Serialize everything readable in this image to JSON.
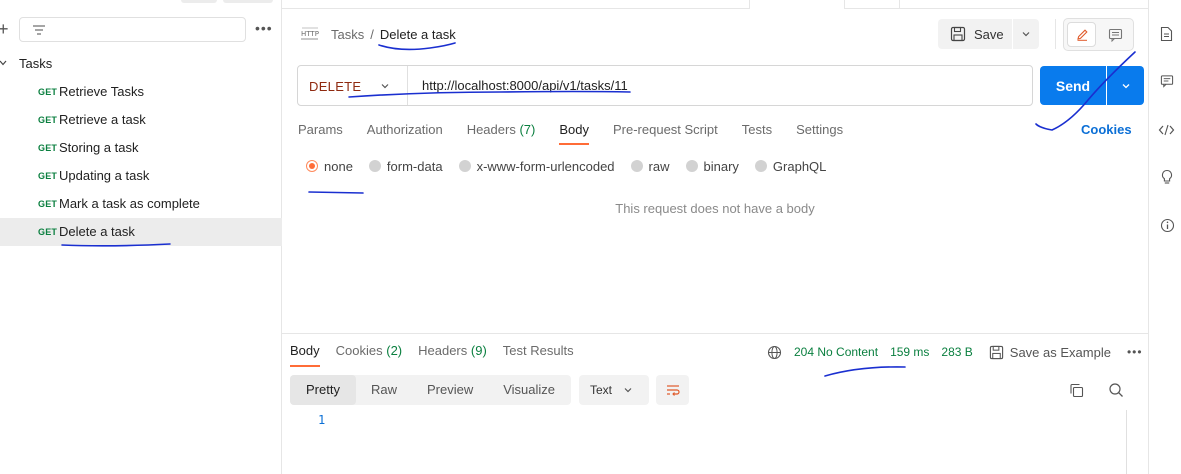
{
  "sidebar": {
    "collection_name": "Tasks",
    "requests": [
      {
        "method": "GET",
        "name": "Retrieve Tasks"
      },
      {
        "method": "GET",
        "name": "Retrieve a task"
      },
      {
        "method": "GET",
        "name": "Storing a task"
      },
      {
        "method": "GET",
        "name": "Updating a task"
      },
      {
        "method": "GET",
        "name": "Mark a task as complete"
      },
      {
        "method": "GET",
        "name": "Delete a task",
        "active": true
      }
    ]
  },
  "header": {
    "breadcrumb_parent": "Tasks",
    "breadcrumb_separator": "/",
    "breadcrumb_current": "Delete a task",
    "save_label": "Save"
  },
  "request": {
    "method": "DELETE",
    "url": "http://localhost:8000/api/v1/tasks/11",
    "send_label": "Send",
    "tabs": [
      {
        "label": "Params"
      },
      {
        "label": "Authorization"
      },
      {
        "label": "Headers",
        "count": "(7)"
      },
      {
        "label": "Body",
        "active": true
      },
      {
        "label": "Pre-request Script"
      },
      {
        "label": "Tests"
      },
      {
        "label": "Settings"
      }
    ],
    "cookies_label": "Cookies",
    "body_types": [
      {
        "label": "none",
        "selected": true
      },
      {
        "label": "form-data"
      },
      {
        "label": "x-www-form-urlencoded"
      },
      {
        "label": "raw"
      },
      {
        "label": "binary"
      },
      {
        "label": "GraphQL"
      }
    ],
    "no_body_text": "This request does not have a body"
  },
  "response": {
    "tabs": [
      {
        "label": "Body",
        "active": true
      },
      {
        "label": "Cookies",
        "count": "(2)"
      },
      {
        "label": "Headers",
        "count": "(9)"
      },
      {
        "label": "Test Results"
      }
    ],
    "status": "204 No Content",
    "time": "159 ms",
    "size": "283 B",
    "save_example_label": "Save as Example",
    "views": [
      "Pretty",
      "Raw",
      "Preview",
      "Visualize"
    ],
    "active_view": "Pretty",
    "format": "Text",
    "line_number": "1"
  },
  "colors": {
    "accent_orange": "#ff6c37",
    "send_blue": "#097bed",
    "get_green": "#0a7f3f",
    "delete_red": "#8f2a10",
    "annotation_ink": "#1a2fd0"
  },
  "icons": {
    "http": "http-icon",
    "save": "floppy-disk-icon",
    "edit": "pencil-icon",
    "comments": "comment-icon",
    "globe": "globe-icon",
    "copy": "copy-icon",
    "search": "search-icon",
    "wrap": "wrap-lines-icon",
    "rail": [
      "document-icon",
      "comment-icon",
      "code-icon",
      "lightbulb-icon",
      "info-icon"
    ]
  }
}
